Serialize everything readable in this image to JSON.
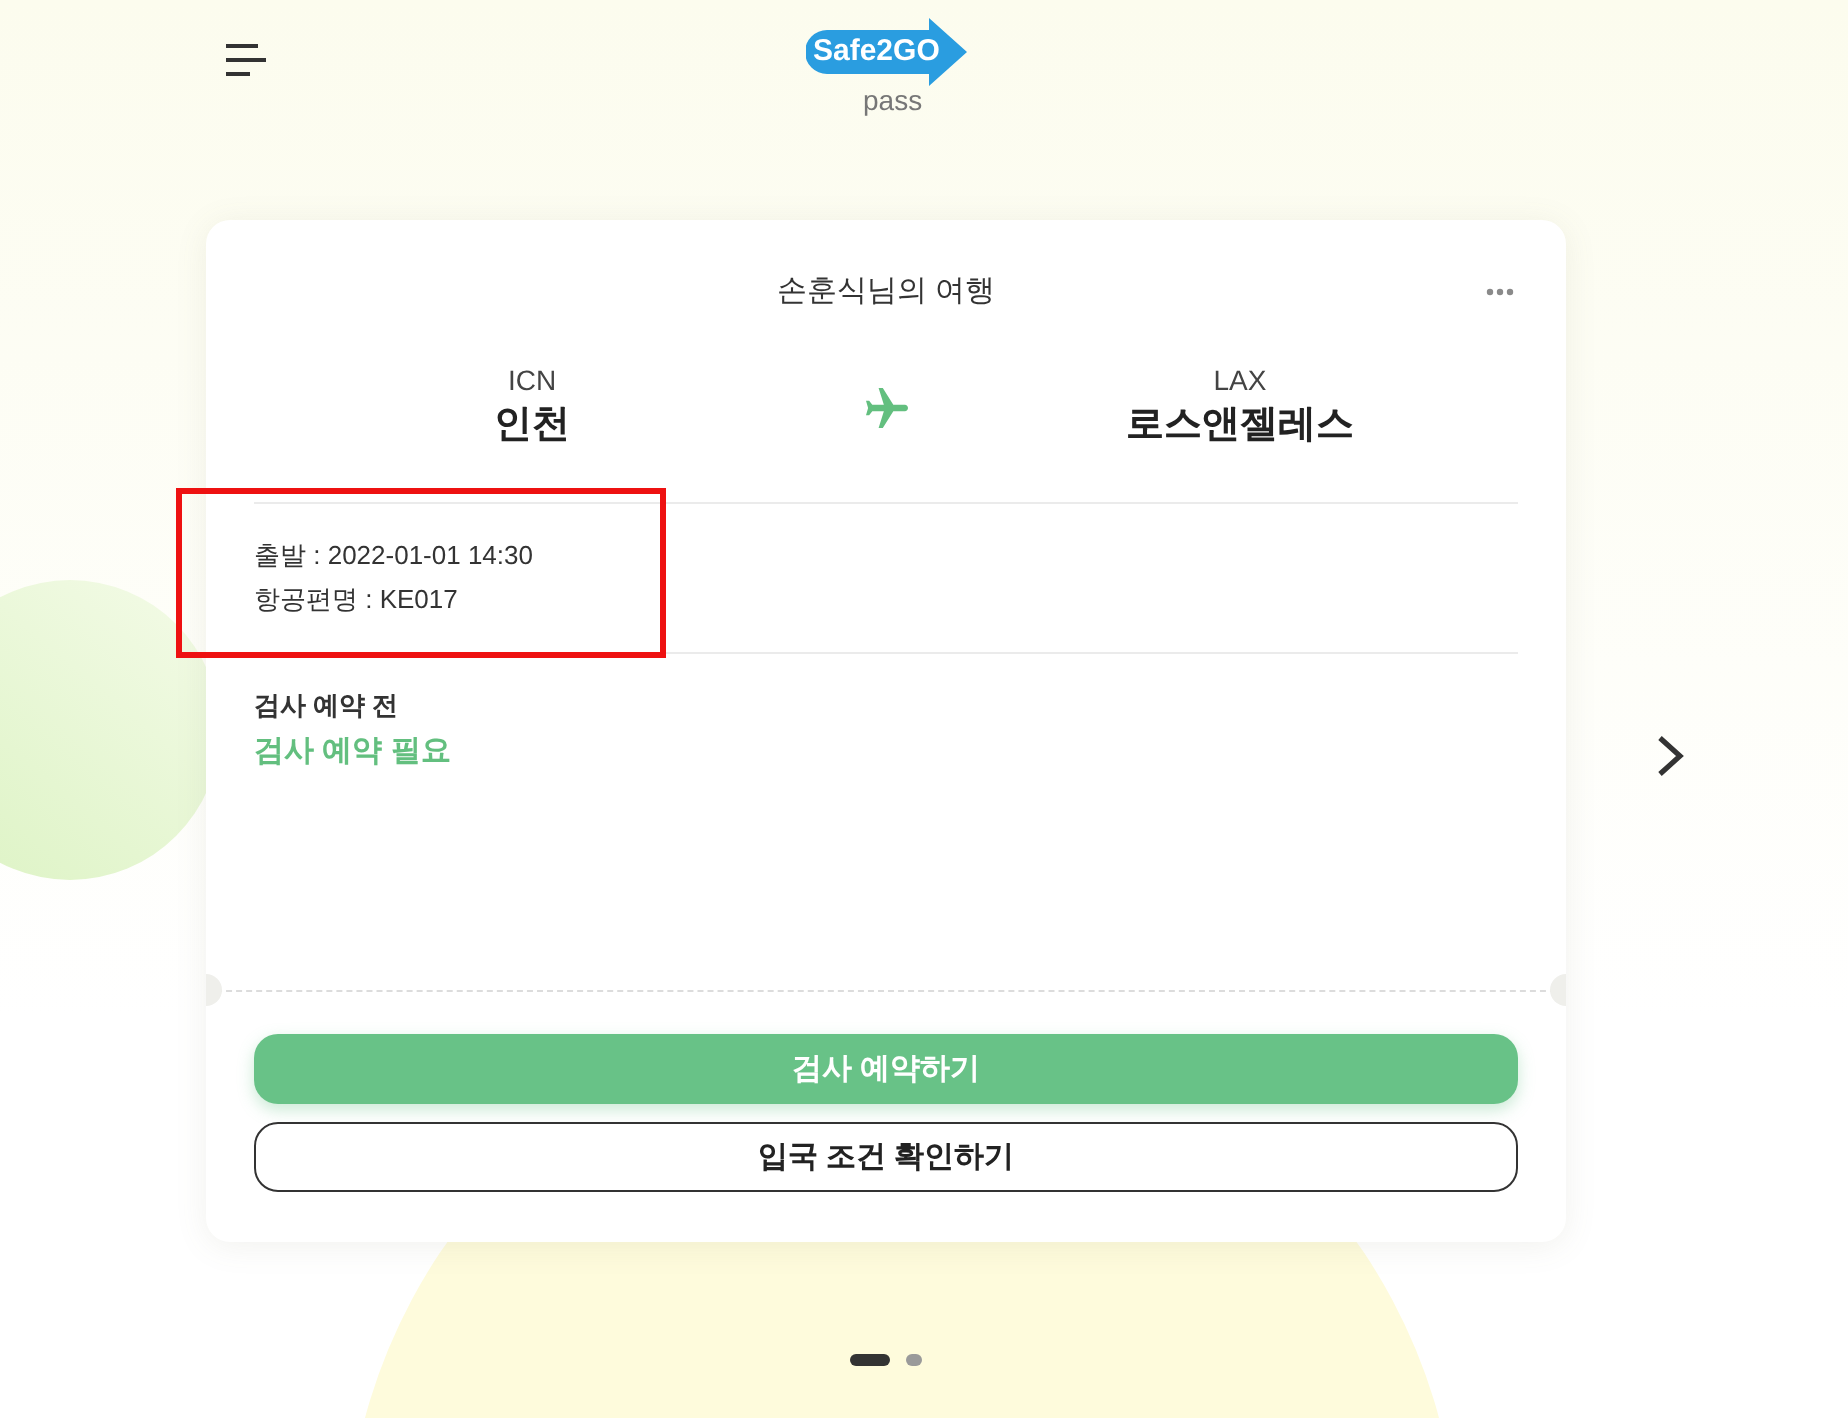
{
  "header": {
    "logo": {
      "wordmark": "Safe2GO",
      "tagline": "pass"
    }
  },
  "trip": {
    "title": "손훈식님의 여행",
    "origin": {
      "code": "ICN",
      "city": "인천"
    },
    "destination": {
      "code": "LAX",
      "city": "로스앤젤레스"
    },
    "details": {
      "highlighted": true,
      "lines": [
        "출발 : 2022-01-01 14:30",
        "항공편명 : KE017"
      ]
    },
    "status": {
      "label": "검사 예약 전",
      "message": "검사 예약 필요"
    },
    "buttons": [
      {
        "label": "검사 예약하기",
        "kind": "primary"
      },
      {
        "label": "입국 조건 확인하기",
        "kind": "outline"
      }
    ]
  },
  "pagination": [
    {
      "selected": true
    },
    {
      "selected": false
    }
  ]
}
